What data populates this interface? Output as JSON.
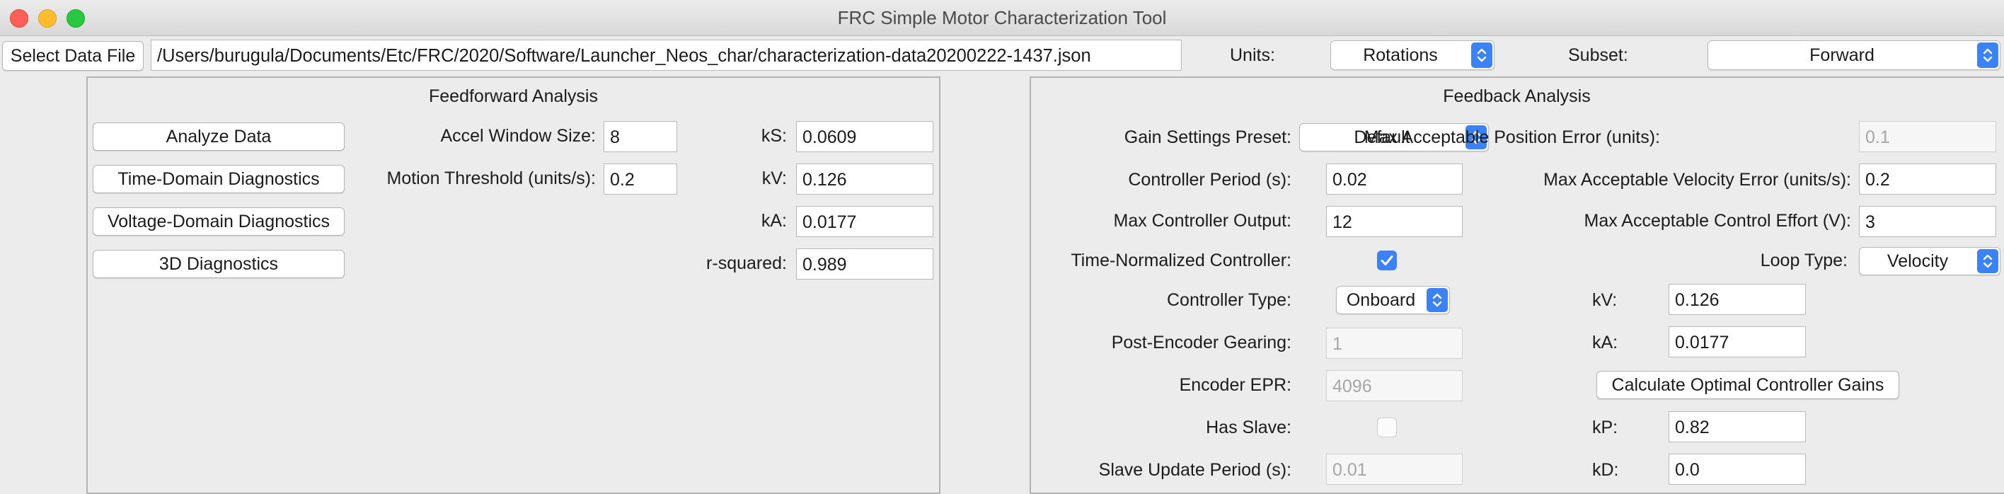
{
  "window": {
    "title": "FRC Simple Motor Characterization Tool"
  },
  "toolbar": {
    "select_file_label": "Select Data File",
    "file_path": "/Users/burugula/Documents/Etc/FRC/2020/Software/Launcher_Neos_char/characterization-data20200222-1437.json",
    "units_label": "Units:",
    "units_value": "Rotations",
    "subset_label": "Subset:",
    "subset_value": "Forward"
  },
  "feedforward": {
    "title": "Feedforward Analysis",
    "buttons": {
      "analyze": "Analyze Data",
      "time_domain": "Time-Domain Diagnostics",
      "voltage_domain": "Voltage-Domain Diagnostics",
      "diag_3d": "3D Diagnostics"
    },
    "accel_window_label": "Accel Window Size:",
    "accel_window_value": "8",
    "motion_threshold_label": "Motion Threshold (units/s):",
    "motion_threshold_value": "0.2",
    "ks_label": "kS:",
    "ks_value": "0.0609",
    "kv_label": "kV:",
    "kv_value": "0.126",
    "ka_label": "kA:",
    "ka_value": "0.0177",
    "r2_label": "r-squared:",
    "r2_value": "0.989"
  },
  "feedback": {
    "title": "Feedback Analysis",
    "gain_preset_label": "Gain Settings Preset:",
    "gain_preset_value": "Default",
    "controller_period_label": "Controller Period (s):",
    "controller_period_value": "0.02",
    "max_output_label": "Max Controller Output:",
    "max_output_value": "12",
    "time_normalized_label": "Time-Normalized Controller:",
    "time_normalized_checked": true,
    "controller_type_label": "Controller Type:",
    "controller_type_value": "Onboard",
    "post_encoder_label": "Post-Encoder Gearing:",
    "post_encoder_value": "1",
    "encoder_epr_label": "Encoder EPR:",
    "encoder_epr_value": "4096",
    "has_slave_label": "Has Slave:",
    "has_slave_checked": false,
    "slave_period_label": "Slave Update Period (s):",
    "slave_period_value": "0.01",
    "max_pos_err_label": "Max Acceptable Position Error (units):",
    "max_pos_err_value": "0.1",
    "max_vel_err_label": "Max Acceptable Velocity Error (units/s):",
    "max_vel_err_value": "0.2",
    "max_effort_label": "Max Acceptable Control Effort (V):",
    "max_effort_value": "3",
    "loop_type_label": "Loop Type:",
    "loop_type_value": "Velocity",
    "kv_label": "kV:",
    "kv_value": "0.126",
    "ka_label": "kA:",
    "ka_value": "0.0177",
    "calc_button": "Calculate Optimal Controller Gains",
    "kp_label": "kP:",
    "kp_value": "0.82",
    "kd_label": "kD:",
    "kd_value": "0.0"
  },
  "colors": {
    "accent": "#3b82f6",
    "close": "#fe5f57",
    "minimize": "#febc2e",
    "zoom": "#28c840"
  }
}
